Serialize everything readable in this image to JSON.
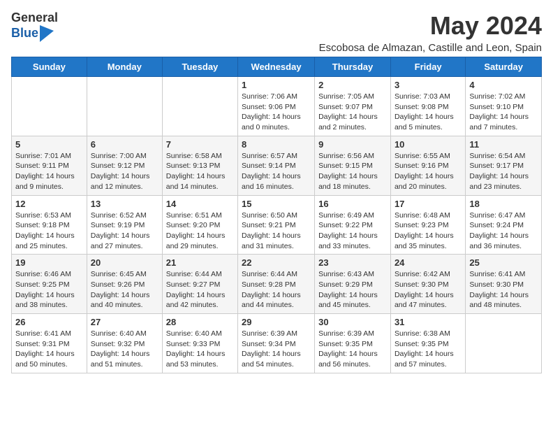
{
  "logo": {
    "general": "General",
    "blue": "Blue"
  },
  "title": "May 2024",
  "subtitle": "Escobosa de Almazan, Castille and Leon, Spain",
  "header_days": [
    "Sunday",
    "Monday",
    "Tuesday",
    "Wednesday",
    "Thursday",
    "Friday",
    "Saturday"
  ],
  "weeks": [
    {
      "days": [
        {
          "num": "",
          "info": ""
        },
        {
          "num": "",
          "info": ""
        },
        {
          "num": "",
          "info": ""
        },
        {
          "num": "1",
          "info": "Sunrise: 7:06 AM\nSunset: 9:06 PM\nDaylight: 14 hours\nand 0 minutes."
        },
        {
          "num": "2",
          "info": "Sunrise: 7:05 AM\nSunset: 9:07 PM\nDaylight: 14 hours\nand 2 minutes."
        },
        {
          "num": "3",
          "info": "Sunrise: 7:03 AM\nSunset: 9:08 PM\nDaylight: 14 hours\nand 5 minutes."
        },
        {
          "num": "4",
          "info": "Sunrise: 7:02 AM\nSunset: 9:10 PM\nDaylight: 14 hours\nand 7 minutes."
        }
      ]
    },
    {
      "days": [
        {
          "num": "5",
          "info": "Sunrise: 7:01 AM\nSunset: 9:11 PM\nDaylight: 14 hours\nand 9 minutes."
        },
        {
          "num": "6",
          "info": "Sunrise: 7:00 AM\nSunset: 9:12 PM\nDaylight: 14 hours\nand 12 minutes."
        },
        {
          "num": "7",
          "info": "Sunrise: 6:58 AM\nSunset: 9:13 PM\nDaylight: 14 hours\nand 14 minutes."
        },
        {
          "num": "8",
          "info": "Sunrise: 6:57 AM\nSunset: 9:14 PM\nDaylight: 14 hours\nand 16 minutes."
        },
        {
          "num": "9",
          "info": "Sunrise: 6:56 AM\nSunset: 9:15 PM\nDaylight: 14 hours\nand 18 minutes."
        },
        {
          "num": "10",
          "info": "Sunrise: 6:55 AM\nSunset: 9:16 PM\nDaylight: 14 hours\nand 20 minutes."
        },
        {
          "num": "11",
          "info": "Sunrise: 6:54 AM\nSunset: 9:17 PM\nDaylight: 14 hours\nand 23 minutes."
        }
      ]
    },
    {
      "days": [
        {
          "num": "12",
          "info": "Sunrise: 6:53 AM\nSunset: 9:18 PM\nDaylight: 14 hours\nand 25 minutes."
        },
        {
          "num": "13",
          "info": "Sunrise: 6:52 AM\nSunset: 9:19 PM\nDaylight: 14 hours\nand 27 minutes."
        },
        {
          "num": "14",
          "info": "Sunrise: 6:51 AM\nSunset: 9:20 PM\nDaylight: 14 hours\nand 29 minutes."
        },
        {
          "num": "15",
          "info": "Sunrise: 6:50 AM\nSunset: 9:21 PM\nDaylight: 14 hours\nand 31 minutes."
        },
        {
          "num": "16",
          "info": "Sunrise: 6:49 AM\nSunset: 9:22 PM\nDaylight: 14 hours\nand 33 minutes."
        },
        {
          "num": "17",
          "info": "Sunrise: 6:48 AM\nSunset: 9:23 PM\nDaylight: 14 hours\nand 35 minutes."
        },
        {
          "num": "18",
          "info": "Sunrise: 6:47 AM\nSunset: 9:24 PM\nDaylight: 14 hours\nand 36 minutes."
        }
      ]
    },
    {
      "days": [
        {
          "num": "19",
          "info": "Sunrise: 6:46 AM\nSunset: 9:25 PM\nDaylight: 14 hours\nand 38 minutes."
        },
        {
          "num": "20",
          "info": "Sunrise: 6:45 AM\nSunset: 9:26 PM\nDaylight: 14 hours\nand 40 minutes."
        },
        {
          "num": "21",
          "info": "Sunrise: 6:44 AM\nSunset: 9:27 PM\nDaylight: 14 hours\nand 42 minutes."
        },
        {
          "num": "22",
          "info": "Sunrise: 6:44 AM\nSunset: 9:28 PM\nDaylight: 14 hours\nand 44 minutes."
        },
        {
          "num": "23",
          "info": "Sunrise: 6:43 AM\nSunset: 9:29 PM\nDaylight: 14 hours\nand 45 minutes."
        },
        {
          "num": "24",
          "info": "Sunrise: 6:42 AM\nSunset: 9:30 PM\nDaylight: 14 hours\nand 47 minutes."
        },
        {
          "num": "25",
          "info": "Sunrise: 6:41 AM\nSunset: 9:30 PM\nDaylight: 14 hours\nand 48 minutes."
        }
      ]
    },
    {
      "days": [
        {
          "num": "26",
          "info": "Sunrise: 6:41 AM\nSunset: 9:31 PM\nDaylight: 14 hours\nand 50 minutes."
        },
        {
          "num": "27",
          "info": "Sunrise: 6:40 AM\nSunset: 9:32 PM\nDaylight: 14 hours\nand 51 minutes."
        },
        {
          "num": "28",
          "info": "Sunrise: 6:40 AM\nSunset: 9:33 PM\nDaylight: 14 hours\nand 53 minutes."
        },
        {
          "num": "29",
          "info": "Sunrise: 6:39 AM\nSunset: 9:34 PM\nDaylight: 14 hours\nand 54 minutes."
        },
        {
          "num": "30",
          "info": "Sunrise: 6:39 AM\nSunset: 9:35 PM\nDaylight: 14 hours\nand 56 minutes."
        },
        {
          "num": "31",
          "info": "Sunrise: 6:38 AM\nSunset: 9:35 PM\nDaylight: 14 hours\nand 57 minutes."
        },
        {
          "num": "",
          "info": ""
        }
      ]
    }
  ]
}
